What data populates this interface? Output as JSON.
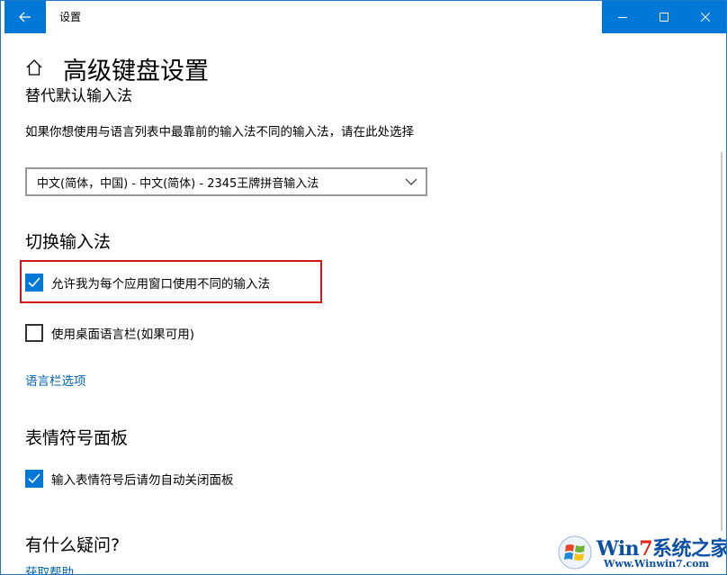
{
  "window": {
    "title": "设置",
    "controls": {
      "minimize": "minimize",
      "maximize": "maximize",
      "close": "close"
    }
  },
  "page": {
    "title": "高级键盘设置"
  },
  "override_section": {
    "heading_partial": "替代默认输入法",
    "description": "如果你想使用与语言列表中最靠前的输入法不同的输入法，请在此处选择",
    "select_value": "中文(简体，中国) - 中文(简体) - 2345王牌拼音输入法"
  },
  "switch_section": {
    "heading": "切换输入法",
    "options": [
      {
        "label": "允许我为每个应用窗口使用不同的输入法",
        "checked": true
      },
      {
        "label": "使用桌面语言栏(如果可用)",
        "checked": false
      }
    ],
    "link": "语言栏选项"
  },
  "emoji_section": {
    "heading": "表情符号面板",
    "options": [
      {
        "label": "输入表情符号后请勿自动关闭面板",
        "checked": true
      }
    ]
  },
  "help_section": {
    "heading": "有什么疑问?",
    "link": "获取帮助"
  },
  "watermark": {
    "brand_prefix": "Win",
    "brand_seven": "7",
    "brand_suffix": "系统之家",
    "url": "Www.Winwin7.com"
  },
  "colors": {
    "accent": "#0078d7",
    "link": "#0063b1",
    "highlight": "#d0161b"
  }
}
